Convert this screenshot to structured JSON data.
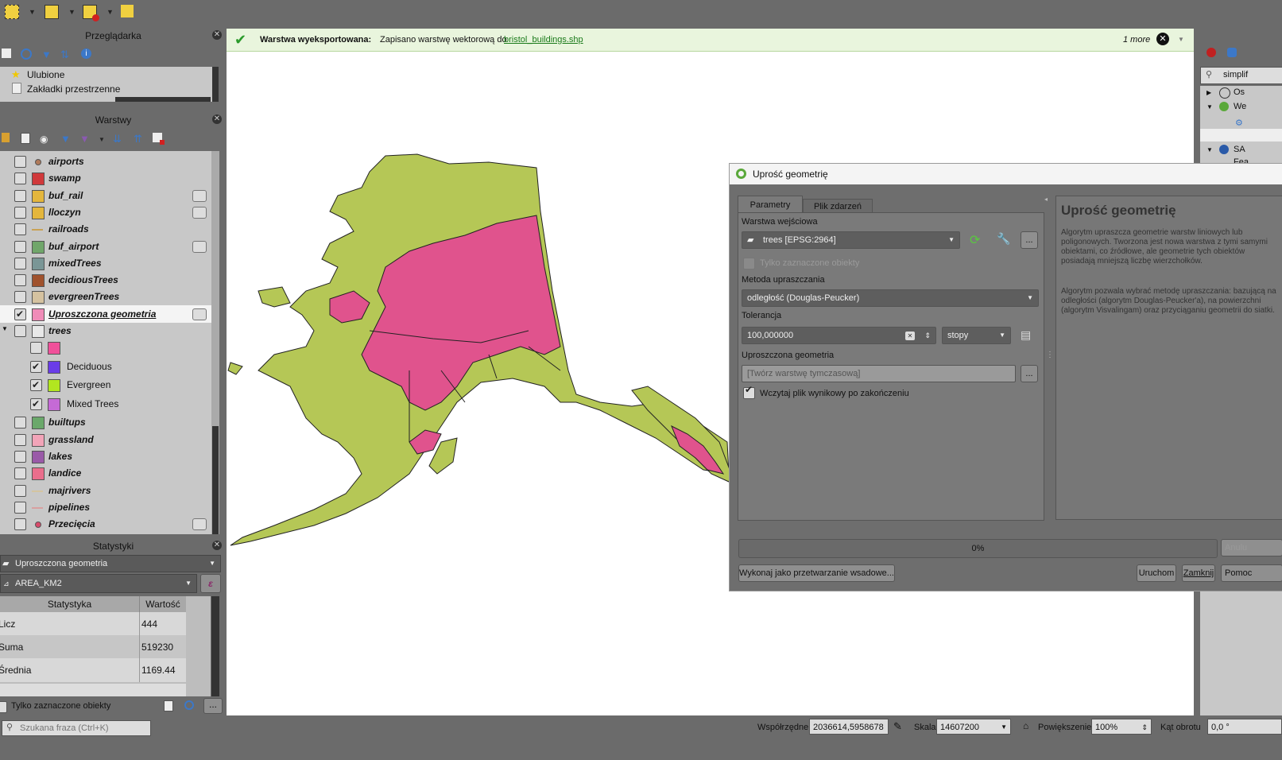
{
  "colors": {
    "accent_green": "#b5c756",
    "pink": "#e0538d",
    "msg_bg": "#e9f5dd"
  },
  "browser": {
    "title": "Przeglądarka",
    "items": [
      "Ulubione",
      "Zakładki przestrzenne"
    ]
  },
  "layers": {
    "title": "Warstwy",
    "items": [
      {
        "name": "airports",
        "color": "#b07a5a",
        "checked": false,
        "sym": "point"
      },
      {
        "name": "swamp",
        "color": "#d0393b",
        "checked": false
      },
      {
        "name": "buf_rail",
        "color": "#e4b63c",
        "checked": false,
        "ind": true
      },
      {
        "name": "lloczyn",
        "color": "#e4b63c",
        "checked": false,
        "ind": true
      },
      {
        "name": "railroads",
        "color": "#c9a255",
        "checked": false,
        "sym": "line"
      },
      {
        "name": "buf_airport",
        "color": "#70a66a",
        "checked": false,
        "ind": true
      },
      {
        "name": "mixedTrees",
        "color": "#7a9696",
        "checked": false
      },
      {
        "name": "decidiousTrees",
        "color": "#a0522d",
        "checked": false
      },
      {
        "name": "evergreenTrees",
        "color": "#d5c2a0",
        "checked": false
      },
      {
        "name": "Uproszczona geometria",
        "color": "#f08cb8",
        "checked": true,
        "ind": true,
        "selected": true
      },
      {
        "name": "trees",
        "color": "#e8e8e8",
        "checked": false,
        "sym": "poly"
      }
    ],
    "subitems": [
      {
        "name": "",
        "color": "#f0509a",
        "checked": false
      },
      {
        "name": "Deciduous",
        "color": "#6a3ce8",
        "checked": true
      },
      {
        "name": "Evergreen",
        "color": "#b2e620",
        "checked": true
      },
      {
        "name": "Mixed Trees",
        "color": "#c56ad6",
        "checked": true
      }
    ],
    "items2": [
      {
        "name": "builtups",
        "color": "#6aa86a",
        "checked": false
      },
      {
        "name": "grassland",
        "color": "#f2a4b8",
        "checked": false
      },
      {
        "name": "lakes",
        "color": "#9a5aa8",
        "checked": false
      },
      {
        "name": "landice",
        "color": "#ea6e8c",
        "checked": false
      },
      {
        "name": "majrivers",
        "color": "#d4c4a0",
        "checked": false,
        "sym": "line"
      },
      {
        "name": "pipelines",
        "color": "#d8a0a0",
        "checked": false,
        "sym": "line"
      },
      {
        "name": "Przecięcia",
        "color": "#d84a6a",
        "checked": false,
        "sym": "point",
        "ind": true
      }
    ]
  },
  "stats": {
    "title": "Statystyki",
    "layer": "Uproszczona geometria",
    "field": "AREA_KM2",
    "col_stat": "Statystyka",
    "col_val": "Wartość",
    "rows": [
      [
        "Licz",
        "444"
      ],
      [
        "Suma",
        "519230"
      ],
      [
        "Średnia",
        "1169.44"
      ]
    ],
    "only_selected": "Tylko zaznaczone obiekty"
  },
  "search": {
    "placeholder": "Szukana fraza (Ctrl+K)"
  },
  "message": {
    "bold": "Warstwa wyeksportowana:",
    "text": "Zapisano warstwę wektorową do",
    "link": "bristol_buildings.shp",
    "more": "1 more"
  },
  "right": {
    "search": "simplif",
    "items": [
      "Os",
      "We",
      "SA",
      "Fea"
    ]
  },
  "dialog": {
    "title": "Uprość geometrię",
    "tab1": "Parametry",
    "tab2": "Plik zdarzeń",
    "input_label": "Warstwa wejściowa",
    "input_value": "trees [EPSG:2964]",
    "only_selected": "Tylko zaznaczone obiekty",
    "method_label": "Metoda upraszczania",
    "method_value": "odległość (Douglas-Peucker)",
    "tol_label": "Tolerancja",
    "tol_value": "100,000000",
    "tol_unit": "stopy",
    "out_label": "Uproszczona geometria",
    "out_placeholder": "[Twórz warstwę tymczasową]",
    "load_result": "Wczytaj plik wynikowy po zakończeniu",
    "help_title": "Uprość geometrię",
    "help_p1": "Algorytm upraszcza geometrie warstw liniowych lub poligonowych. Tworzona jest nowa warstwa z tymi samymi obiektami, co źródłowe, ale geometrie tych obiektów posiadają mniejszą liczbę wierzchołków.",
    "help_p2": "Algorytm pozwala wybrać metodę upraszczania: bazującą na odległości (algorytm Douglas-Peucker'a), na powierzchni (algorytm Visvalingam) oraz przyciąganiu geometrii do siatki.",
    "progress": "0%",
    "cancel": "Anulu",
    "batch": "Wykonaj jako przetwarzanie wsadowe...",
    "run": "Uruchom",
    "close": "Zamknij",
    "help": "Pomoc"
  },
  "status": {
    "coord_label": "Współrzędne",
    "coord": "2036614,5958678",
    "scale_label": "Skala",
    "scale": "14607200",
    "zoom_label": "Powiększenie",
    "zoom": "100%",
    "rot_label": "Kąt obrotu",
    "rot": "0,0 °"
  }
}
